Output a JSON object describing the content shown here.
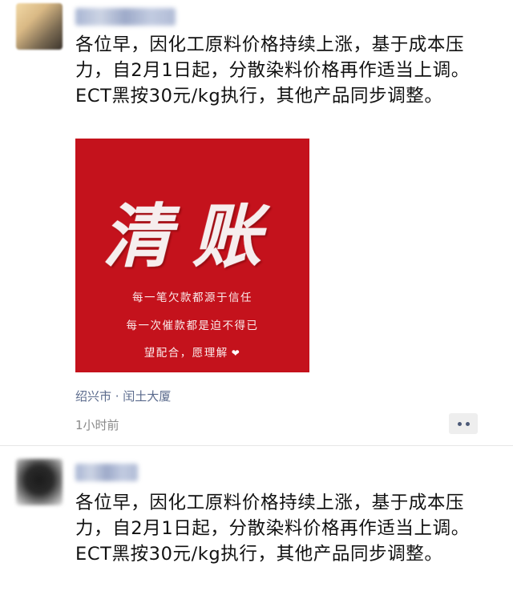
{
  "posts": [
    {
      "nickname": "",
      "body": "各位早，因化工原料价格持续上涨，基于成本压力，自2月1日起，分散染料价格再作适当上调。ECT黑按30元/kg执行，其他产品同步调整。",
      "image": {
        "headline": "清账",
        "line1": "每一笔欠款都源于信任",
        "line2": "每一次催款都是迫不得已",
        "line3": "望配合，愿理解",
        "heart_icon": "heart-icon",
        "background_color": "#c4121c"
      },
      "location": "绍兴市 · 闰土大厦",
      "timestamp": "1小时前",
      "more_icon": "more-dots-icon"
    },
    {
      "nickname": "",
      "body": "各位早，因化工原料价格持续上涨，基于成本压力，自2月1日起，分散染料价格再作适当上调。ECT黑按30元/kg执行，其他产品同步调整。"
    }
  ],
  "colors": {
    "link_blue": "#5a6a8c",
    "meta_gray": "#8a8a8a"
  }
}
